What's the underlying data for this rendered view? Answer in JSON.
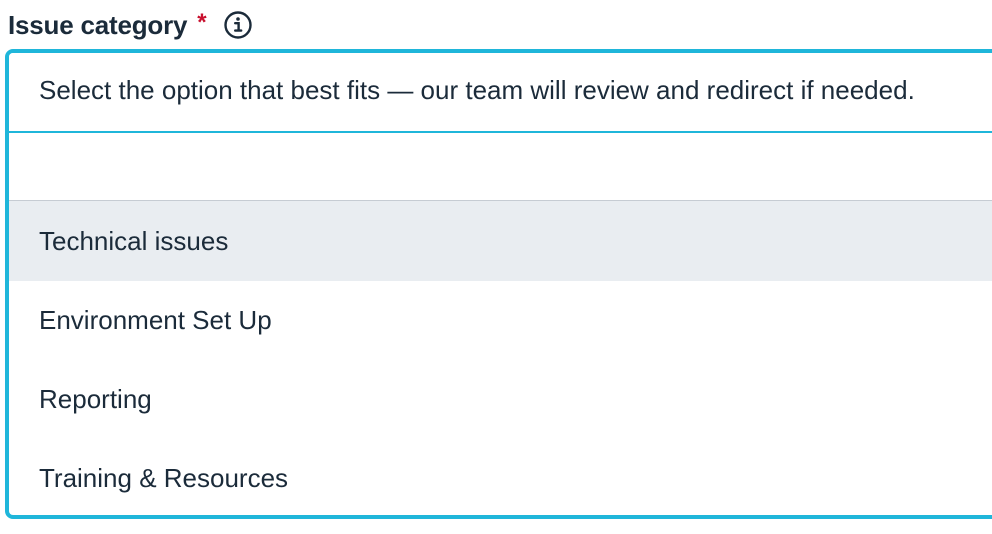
{
  "field": {
    "label": "Issue category",
    "required_mark": "*",
    "info_icon": "info-circle-icon"
  },
  "combobox": {
    "hint": "Select the option that best fits — our team will review and redirect if needed.",
    "search_value": "",
    "highlighted_option": "Technical issues",
    "options": [
      {
        "label": "Technical issues"
      },
      {
        "label": "Environment Set Up"
      },
      {
        "label": "Reporting"
      },
      {
        "label": "Training & Resources"
      }
    ]
  },
  "colors": {
    "focus_border": "#1fb6da",
    "highlight_bg": "#e9edf1",
    "required": "#c8102e",
    "text": "#1b2b3a"
  }
}
